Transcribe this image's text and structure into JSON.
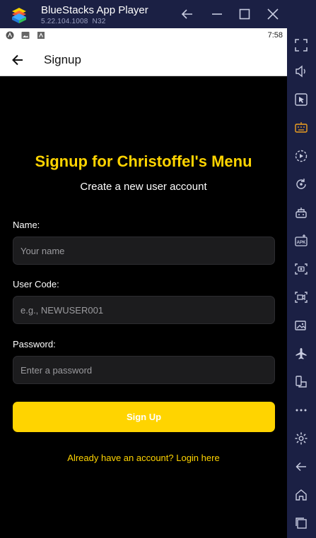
{
  "window": {
    "title": "BlueStacks App Player",
    "version": "5.22.104.1008",
    "build": "N32"
  },
  "statusbar": {
    "time": "7:58"
  },
  "appbar": {
    "title": "Signup"
  },
  "form": {
    "heading": "Signup for Christoffel's Menu",
    "subheading": "Create a new user account",
    "name_label": "Name:",
    "name_placeholder": "Your name",
    "code_label": "User Code:",
    "code_placeholder": "e.g., NEWUSER001",
    "password_label": "Password:",
    "password_placeholder": "Enter a password",
    "submit_label": "Sign Up",
    "login_link": "Already have an account? Login here"
  },
  "colors": {
    "accent": "#ffd400",
    "background": "#000000",
    "chrome": "#1b2044"
  },
  "sidebar_icons": [
    "expand-icon",
    "volume-icon",
    "pointer-icon",
    "keyboard-icon",
    "macro-play-icon",
    "rotate-icon",
    "game-controls-icon",
    "apk-icon",
    "screenshot-icon",
    "record-icon",
    "media-icon",
    "airplane-icon",
    "multi-instance-icon",
    "more-icon",
    "settings-icon",
    "back-icon",
    "home-icon",
    "recents-icon"
  ]
}
